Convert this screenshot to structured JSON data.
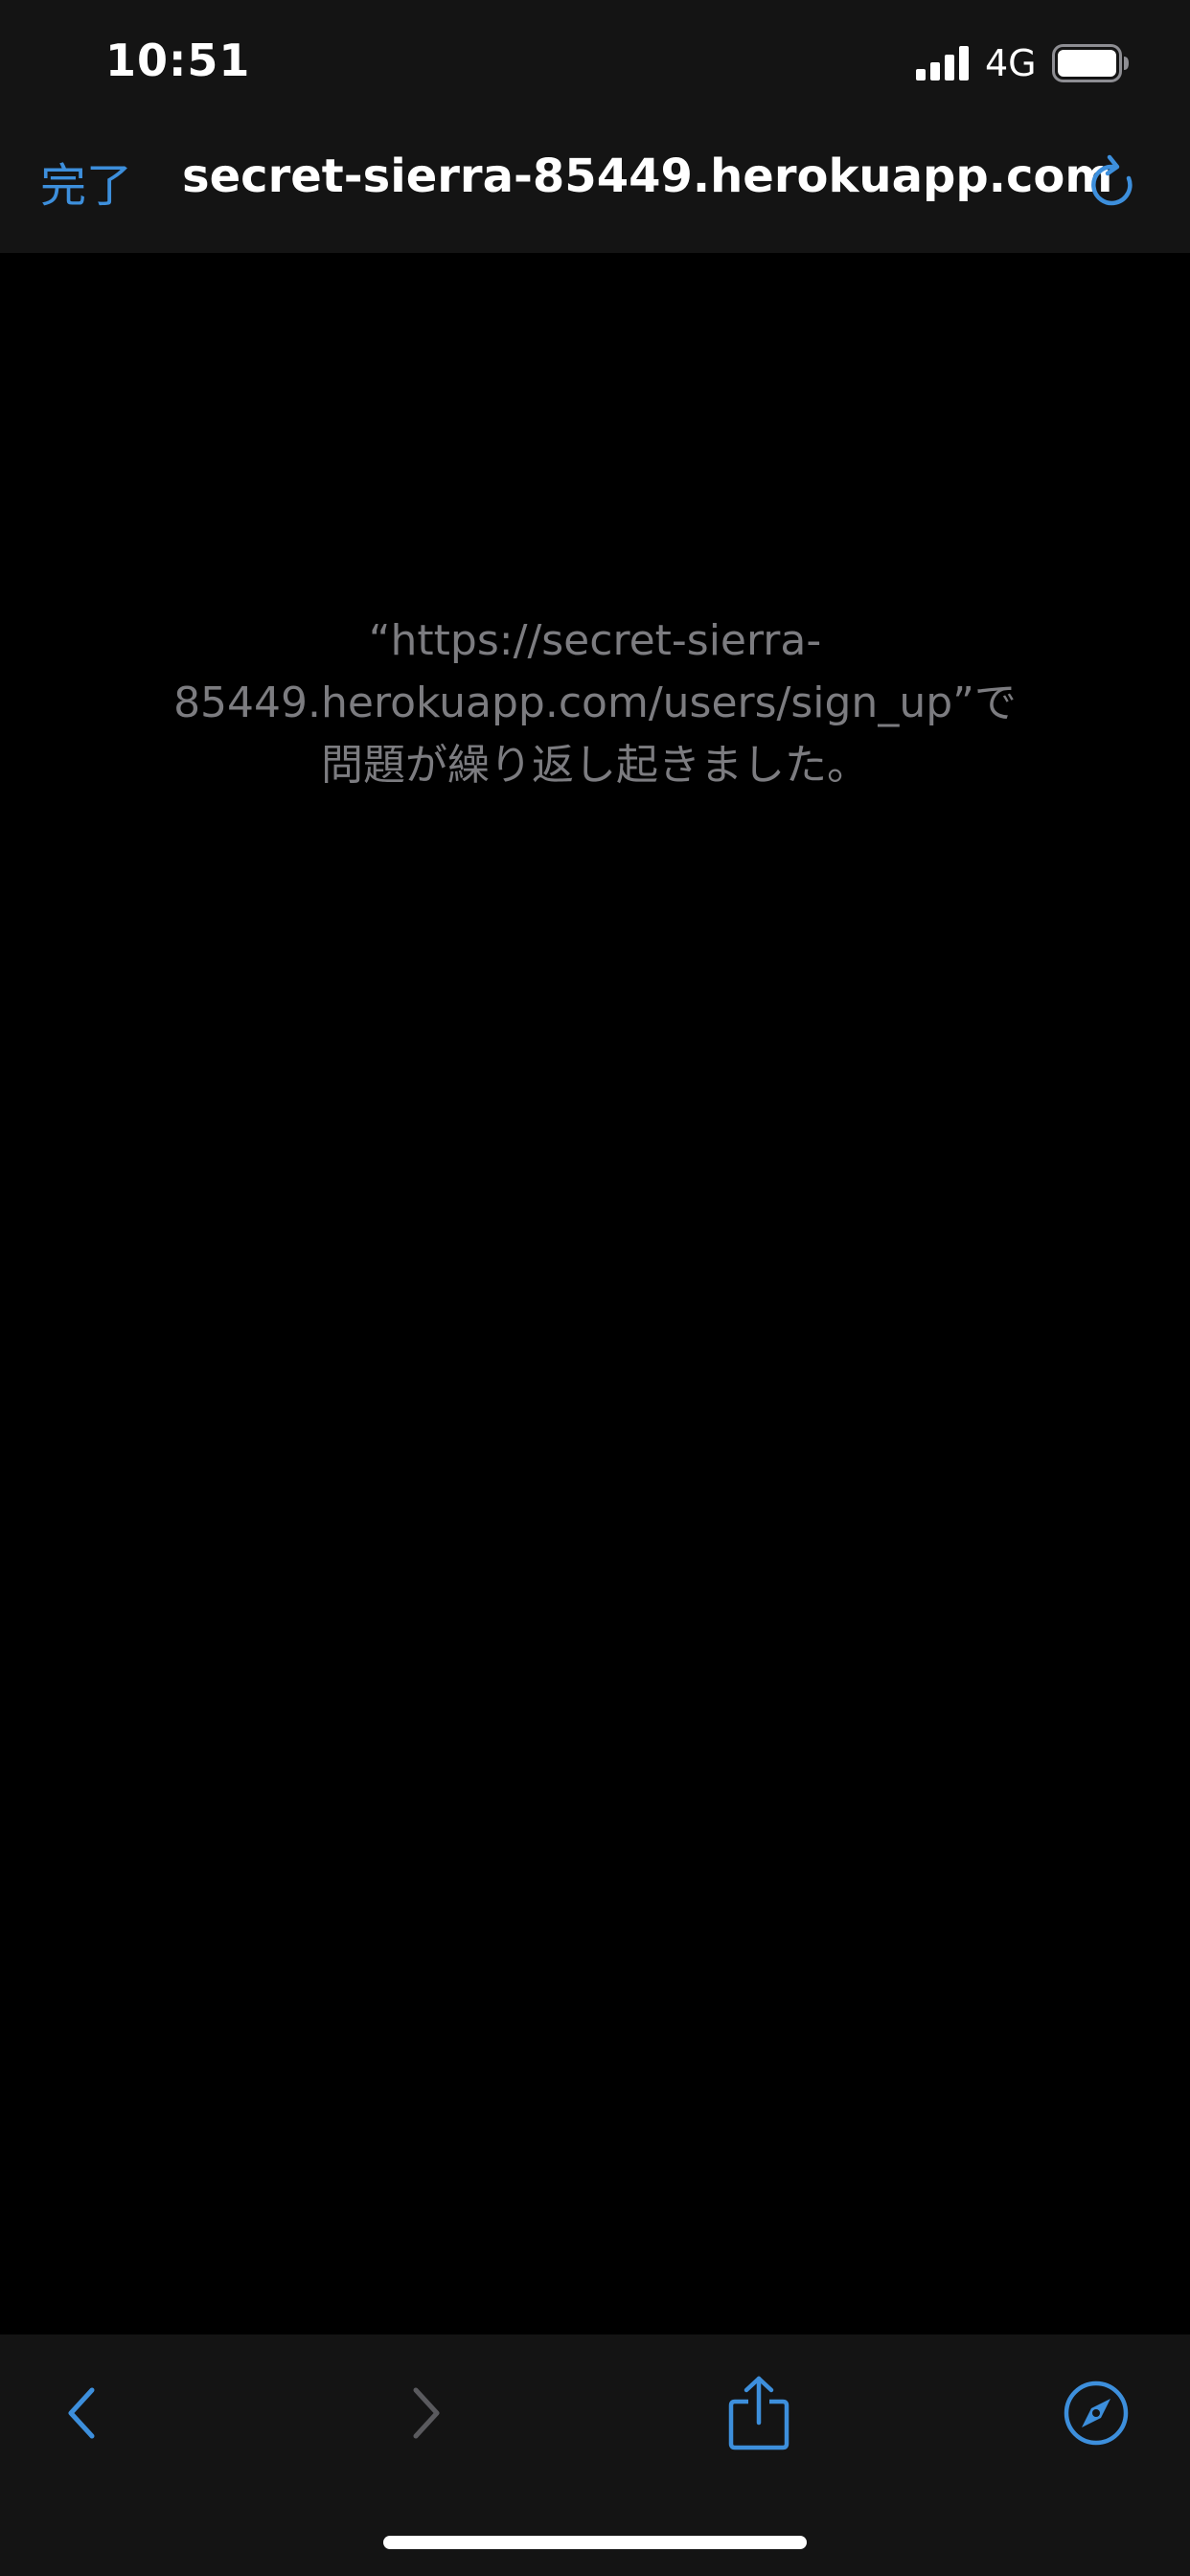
{
  "status_bar": {
    "time": "10:51",
    "network": "4G",
    "signal_icon": "cellular-signal-icon",
    "battery_icon": "battery-icon"
  },
  "nav_bar": {
    "done_label": "完了",
    "url": "secret-sierra-85449.herokuapp.com",
    "reload_icon": "reload-icon"
  },
  "error": {
    "line1": "“https://secret-sierra-",
    "line2": "85449.herokuapp.com/users/sign_up”で",
    "line3": "問題が繰り返し起きました。"
  },
  "toolbar": {
    "back_icon": "chevron-left-icon",
    "forward_icon": "chevron-right-icon",
    "share_icon": "share-icon",
    "safari_icon": "compass-icon"
  },
  "colors": {
    "accent": "#3d8fdc",
    "chrome_bg": "#141414",
    "content_bg": "#000000",
    "message_text": "#7c7c80",
    "disabled_icon": "#5a5a5e"
  }
}
